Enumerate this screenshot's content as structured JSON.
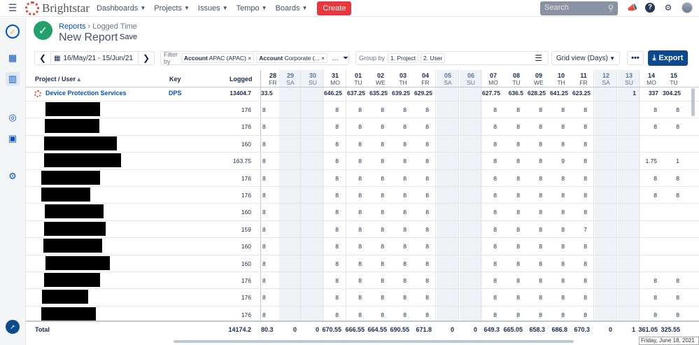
{
  "nav": {
    "brand": "Brightstar",
    "items": [
      "Dashboards",
      "Projects",
      "Issues",
      "Tempo",
      "Boards"
    ],
    "create": "Create",
    "search_placeholder": "Search"
  },
  "header": {
    "breadcrumb_root": "Reports",
    "breadcrumb_current": "Logged Time",
    "title": "New Report",
    "save": "Save"
  },
  "toolbar": {
    "date_range": "16/May/21 - 15/Jun/21",
    "filter_label": "Filter by",
    "filter_chip1_key": "Account",
    "filter_chip1_val": "APAC (APAC)",
    "filter_chip2_key": "Account",
    "filter_chip2_val": "Corporate (...",
    "group_label": "Group by",
    "group_chip1": "1. Project",
    "group_chip2": "2. User",
    "view": "Grid view (Days)",
    "more": "•••",
    "export": "Export"
  },
  "grid": {
    "col_project": "Project / User",
    "col_key": "Key",
    "col_logged": "Logged",
    "days": [
      {
        "n": "28",
        "w": "FR",
        "weekend": false
      },
      {
        "n": "29",
        "w": "SA",
        "weekend": true
      },
      {
        "n": "30",
        "w": "SU",
        "weekend": true
      },
      {
        "n": "31",
        "w": "MO",
        "weekend": false
      },
      {
        "n": "01",
        "w": "TU",
        "weekend": false
      },
      {
        "n": "02",
        "w": "WE",
        "weekend": false
      },
      {
        "n": "03",
        "w": "TH",
        "weekend": false
      },
      {
        "n": "04",
        "w": "FR",
        "weekend": false
      },
      {
        "n": "05",
        "w": "SA",
        "weekend": true
      },
      {
        "n": "06",
        "w": "SU",
        "weekend": true
      },
      {
        "n": "07",
        "w": "MO",
        "weekend": false
      },
      {
        "n": "08",
        "w": "TU",
        "weekend": false
      },
      {
        "n": "09",
        "w": "WE",
        "weekend": false
      },
      {
        "n": "10",
        "w": "TH",
        "weekend": false
      },
      {
        "n": "11",
        "w": "FR",
        "weekend": false
      },
      {
        "n": "12",
        "w": "SA",
        "weekend": true
      },
      {
        "n": "13",
        "w": "SU",
        "weekend": true
      },
      {
        "n": "14",
        "w": "MO",
        "weekend": false
      },
      {
        "n": "15",
        "w": "TU",
        "weekend": false
      }
    ],
    "project": {
      "name": "Device Protection Services",
      "key": "DPS",
      "logged": "13404.7",
      "values": [
        "33.5",
        "",
        "",
        "646.25",
        "637.25",
        "635.25",
        "639.25",
        "629.25",
        "",
        "",
        "627.75",
        "636.5",
        "628.25",
        "641.25",
        "623.25",
        "",
        "1",
        "337",
        "304.25"
      ]
    },
    "rows": [
      {
        "logged": "176",
        "values": [
          "8",
          "",
          "",
          "8",
          "8",
          "8",
          "8",
          "8",
          "",
          "",
          "8",
          "8",
          "8",
          "8",
          "8",
          "",
          "",
          "8",
          "8"
        ]
      },
      {
        "logged": "176",
        "values": [
          "8",
          "",
          "",
          "8",
          "8",
          "8",
          "8",
          "8",
          "",
          "",
          "8",
          "8",
          "8",
          "8",
          "8",
          "",
          "",
          "8",
          "8"
        ]
      },
      {
        "logged": "160",
        "values": [
          "8",
          "",
          "",
          "8",
          "8",
          "8",
          "8",
          "8",
          "",
          "",
          "8",
          "8",
          "8",
          "8",
          "8",
          "",
          "",
          "",
          ""
        ]
      },
      {
        "logged": "163.75",
        "values": [
          "8",
          "",
          "",
          "8",
          "8",
          "8",
          "8",
          "8",
          "",
          "",
          "8",
          "8",
          "8",
          "9",
          "8",
          "",
          "",
          "1.75",
          "1"
        ]
      },
      {
        "logged": "176",
        "values": [
          "8",
          "",
          "",
          "8",
          "8",
          "8",
          "8",
          "8",
          "",
          "",
          "8",
          "8",
          "8",
          "8",
          "8",
          "",
          "",
          "8",
          "8"
        ]
      },
      {
        "logged": "176",
        "values": [
          "8",
          "",
          "",
          "8",
          "8",
          "8",
          "8",
          "8",
          "",
          "",
          "8",
          "8",
          "8",
          "8",
          "8",
          "",
          "",
          "8",
          "8"
        ]
      },
      {
        "logged": "160",
        "values": [
          "8",
          "",
          "",
          "8",
          "8",
          "8",
          "8",
          "8",
          "",
          "",
          "8",
          "8",
          "8",
          "8",
          "8",
          "",
          "",
          "",
          ""
        ]
      },
      {
        "logged": "159",
        "values": [
          "8",
          "",
          "",
          "8",
          "8",
          "8",
          "8",
          "8",
          "",
          "",
          "8",
          "8",
          "8",
          "8",
          "7",
          "",
          "",
          "",
          ""
        ]
      },
      {
        "logged": "160",
        "values": [
          "8",
          "",
          "",
          "8",
          "8",
          "8",
          "8",
          "8",
          "",
          "",
          "8",
          "8",
          "8",
          "8",
          "8",
          "",
          "",
          "",
          ""
        ]
      },
      {
        "logged": "160",
        "values": [
          "8",
          "",
          "",
          "8",
          "8",
          "8",
          "8",
          "8",
          "",
          "",
          "8",
          "8",
          "8",
          "8",
          "8",
          "",
          "",
          "",
          ""
        ]
      },
      {
        "logged": "176",
        "values": [
          "8",
          "",
          "",
          "8",
          "8",
          "8",
          "8",
          "8",
          "",
          "",
          "8",
          "8",
          "8",
          "8",
          "8",
          "",
          "",
          "8",
          "8"
        ]
      },
      {
        "logged": "176",
        "values": [
          "8",
          "",
          "",
          "8",
          "8",
          "8",
          "8",
          "8",
          "",
          "",
          "8",
          "8",
          "8",
          "8",
          "8",
          "",
          "",
          "8",
          "8"
        ]
      },
      {
        "logged": "176",
        "values": [
          "8",
          "",
          "",
          "8",
          "8",
          "8",
          "8",
          "8",
          "",
          "",
          "8",
          "8",
          "8",
          "8",
          "8",
          "",
          "",
          "8",
          "8"
        ]
      }
    ],
    "total_label": "Total",
    "total_logged": "14174.2",
    "totals": [
      "80.3",
      "0",
      "0",
      "670.55",
      "666.55",
      "664.55",
      "690.55",
      "671.8",
      "0",
      "0",
      "649.3",
      "665.05",
      "658.3",
      "686.8",
      "670.3",
      "0",
      "1",
      "361.05",
      "325.55"
    ]
  },
  "tooltip": "Friday, June 18, 2021"
}
